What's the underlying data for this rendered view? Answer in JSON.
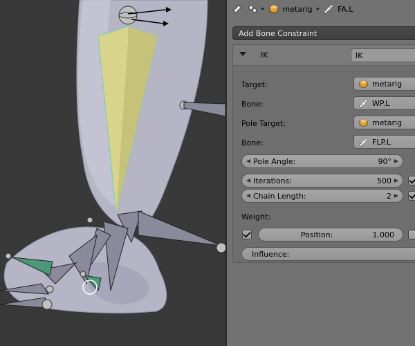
{
  "header": {
    "armature_name": "metarig",
    "bone_name": "FA.L"
  },
  "add_constraint_label": "Add Bone Constraint",
  "constraint": {
    "type_label": "IK",
    "name": "IK",
    "target_label": "Target:",
    "target_value": "metarig",
    "bone_label": "Bone:",
    "bone_value": "WP.L",
    "pole_target_label": "Pole Target:",
    "pole_target_value": "metarig",
    "pole_bone_label": "Bone:",
    "pole_bone_value": "FLP.L",
    "pole_angle_label": "Pole Angle:",
    "pole_angle_value": "90°",
    "iterations_label": "Iterations:",
    "iterations_value": "500",
    "chain_length_label": "Chain Length:",
    "chain_length_value": "2",
    "weight_label": "Weight:",
    "position_label": "Position:",
    "position_value": "1.000",
    "influence_label": "Influence:"
  },
  "colors": {
    "viewport_bg": "#393939",
    "panel_bg": "#727272",
    "selected_bone": "#d8d48a",
    "ik_bone": "#4a9a78",
    "mesh": "#b4b4c8"
  },
  "icons": [
    "pin-icon",
    "data-icon",
    "armature-object-icon",
    "bone-icon",
    "chevron-right-icon",
    "chevron-down-icon",
    "arrow-left-icon",
    "arrow-right-icon"
  ]
}
